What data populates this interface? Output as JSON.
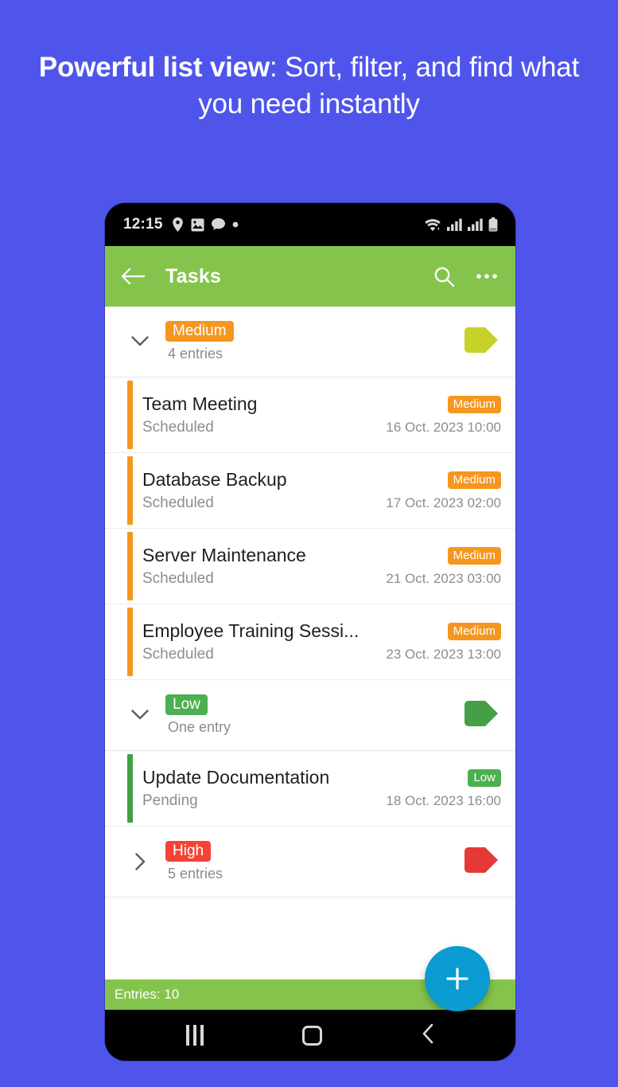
{
  "promo": {
    "bold_part": "Powerful list view",
    "rest_part": ": Sort, filter, and find what you need instantly"
  },
  "colors": {
    "background": "#4f55eb",
    "app_bar_green": "#85c44c",
    "priority_medium": "#f5971e",
    "priority_low": "#4caf50",
    "priority_high": "#f44336",
    "fab_blue": "#0a9bd1",
    "accent_low_bar": "#43a047",
    "group_tag_medium": "#c6d227"
  },
  "status_bar": {
    "time": "12:15",
    "left_icons": [
      "location-pin-icon",
      "image-icon",
      "chat-bubble-icon",
      "dot-icon"
    ],
    "right_icons": [
      "wifi-icon",
      "signal-icon",
      "signal-icon",
      "battery-icon"
    ]
  },
  "app_bar": {
    "back_icon": "back-arrow-icon",
    "title": "Tasks",
    "search_icon": "search-icon",
    "overflow_icon": "overflow-menu-icon"
  },
  "groups": [
    {
      "priority": "Medium",
      "priority_class": "medium",
      "count_label": "4 entries",
      "expanded": true,
      "chevron": "chevron-down-icon",
      "tag_color": "#c6d227",
      "tasks": [
        {
          "title": "Team Meeting",
          "status": "Scheduled",
          "badge": "Medium",
          "badge_class": "medium",
          "date": "16 Oct. 2023 10:00"
        },
        {
          "title": "Database Backup",
          "status": "Scheduled",
          "badge": "Medium",
          "badge_class": "medium",
          "date": "17 Oct. 2023 02:00"
        },
        {
          "title": "Server Maintenance",
          "status": "Scheduled",
          "badge": "Medium",
          "badge_class": "medium",
          "date": "21 Oct. 2023 03:00"
        },
        {
          "title": "Employee Training Sessi...",
          "status": "Scheduled",
          "badge": "Medium",
          "badge_class": "medium",
          "date": "23 Oct. 2023 13:00"
        }
      ]
    },
    {
      "priority": "Low",
      "priority_class": "low",
      "count_label": "One entry",
      "expanded": true,
      "chevron": "chevron-down-icon",
      "tag_color": "#43a047",
      "tasks": [
        {
          "title": "Update Documentation",
          "status": "Pending",
          "badge": "Low",
          "badge_class": "low",
          "date": "18 Oct. 2023 16:00"
        }
      ]
    },
    {
      "priority": "High",
      "priority_class": "high",
      "count_label": "5 entries",
      "expanded": false,
      "chevron": "chevron-right-icon",
      "tag_color": "#e53935",
      "tasks": []
    }
  ],
  "bottom_bar": {
    "entries_label": "Entries: 10"
  },
  "fab": {
    "icon": "plus-icon"
  },
  "nav_bar": {
    "recents_icon": "recents-icon",
    "home_icon": "home-icon",
    "back_icon": "back-chevron-icon"
  }
}
